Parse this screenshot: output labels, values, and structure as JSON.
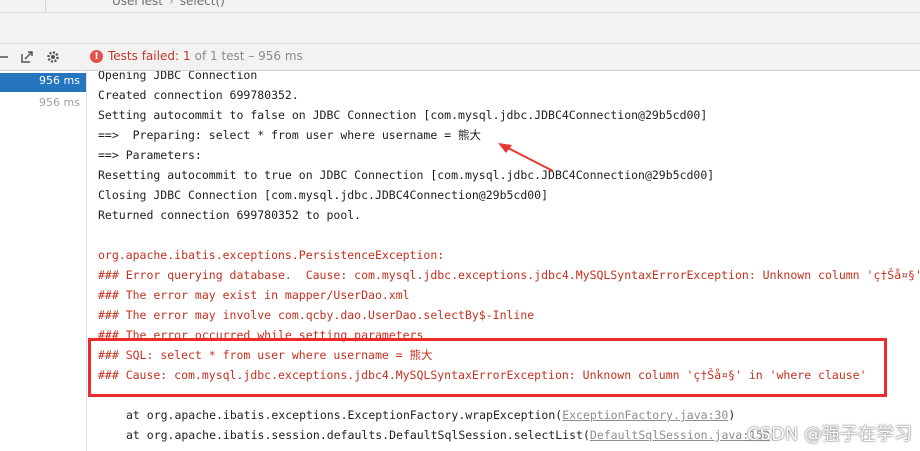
{
  "breadcrumb": {
    "item1": "UserTest",
    "item2": "select()"
  },
  "toolbar": {
    "status_label": "Tests failed:",
    "failed_count": "1",
    "total_text": "of 1 test – 956 ms"
  },
  "tests": [
    {
      "time": "956 ms"
    },
    {
      "time": "956 ms"
    }
  ],
  "console": {
    "l1": "Opening JDBC Connection",
    "l2": "Created connection 699780352.",
    "l3": "Setting autocommit to false on JDBC Connection [com.mysql.jdbc.JDBC4Connection@29b5cd00]",
    "l4": "==>  Preparing: select * from user where username = 熊大",
    "l5": "==> Parameters: ",
    "l6": "Resetting autocommit to true on JDBC Connection [com.mysql.jdbc.JDBC4Connection@29b5cd00]",
    "l7": "Closing JDBC Connection [com.mysql.jdbc.JDBC4Connection@29b5cd00]",
    "l8": "Returned connection 699780352 to pool.",
    "e1": "org.apache.ibatis.exceptions.PersistenceException: ",
    "e2": "### Error querying database.  Cause: com.mysql.jdbc.exceptions.jdbc4.MySQLSyntaxErrorException: Unknown column 'ç†Šå¤§' in 'where clause'",
    "e3": "### The error may exist in mapper/UserDao.xml",
    "e4": "### The error may involve com.qcby.dao.UserDao.selectBy$-Inline",
    "e5": "### The error occurred while setting parameters",
    "e6": "### SQL: select * from user where username = 熊大",
    "e7": "### Cause: com.mysql.jdbc.exceptions.jdbc4.MySQLSyntaxErrorException: Unknown column 'ç†Šå¤§' in 'where clause'",
    "t1_prefix": "at org.apache.ibatis.exceptions.ExceptionFactory.wrapException(",
    "t1_link": "ExceptionFactory.java:30",
    "t1_suffix": ")",
    "t2_prefix": "at org.apache.ibatis.session.defaults.DefaultSqlSession.selectList(",
    "t2_link": "DefaultSqlSession.java:150",
    "t2_suffix": ")"
  },
  "watermark": "CSDN @强子在学习",
  "colors": {
    "error_red": "#c4301f",
    "highlight_box": "#ee2b2b",
    "selection": "#2675bf"
  },
  "icons": [
    "layout-icon",
    "export-icon",
    "settings-icon",
    "error-icon",
    "arrow-annotation"
  ]
}
